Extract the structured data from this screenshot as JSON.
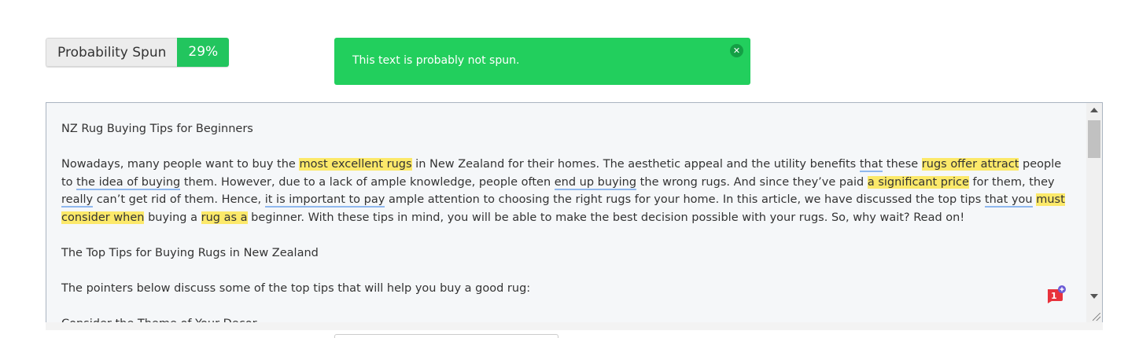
{
  "probability": {
    "label": "Probability Spun",
    "value": "29%"
  },
  "alert": {
    "message": "This text is probably not spun.",
    "close_icon": "close-icon"
  },
  "editor": {
    "title": "NZ Rug Buying Tips for Beginners",
    "para1": {
      "s1": "Nowadays, many people want to buy the ",
      "h1": "most excellent rugs",
      "s2": " in New Zealand for their homes. The aesthetic appeal and the utility benefits ",
      "u1": "that",
      "s3": " these ",
      "h2": "rugs offer attract",
      "s4": " people to ",
      "u2": "the idea of buying",
      "s5": " them. However, due to a lack of ample knowledge, people often ",
      "u3": "end up buying",
      "s6": " the wrong rugs. And since they’ve paid ",
      "h3": "a significant price",
      "s7": " for them, they ",
      "u4": "really",
      "s8": " can’t get rid of them. Hence, ",
      "u5": "it is important to pay",
      "s9": " ample attention to choosing the right rugs for your home. In this article, we have discussed the top tips ",
      "u6": "that you",
      "s10": " ",
      "h4": "must consider when",
      "s11": " buying a ",
      "h5": "rug as a",
      "s12": " beginner. With these tips in mind, you will be able to make the best decision possible with your rugs. So, why wait? Read on!"
    },
    "heading2": "The Top Tips for Buying Rugs in New Zealand",
    "para2": "The pointers below discuss some of the top tips that will help you buy a good rug:",
    "heading3": "Consider the Theme of Your Decor",
    "badge_text": "1"
  },
  "colors": {
    "success": "#22cf5d",
    "highlight": "#fce96a",
    "underline": "#8fb8ef"
  }
}
